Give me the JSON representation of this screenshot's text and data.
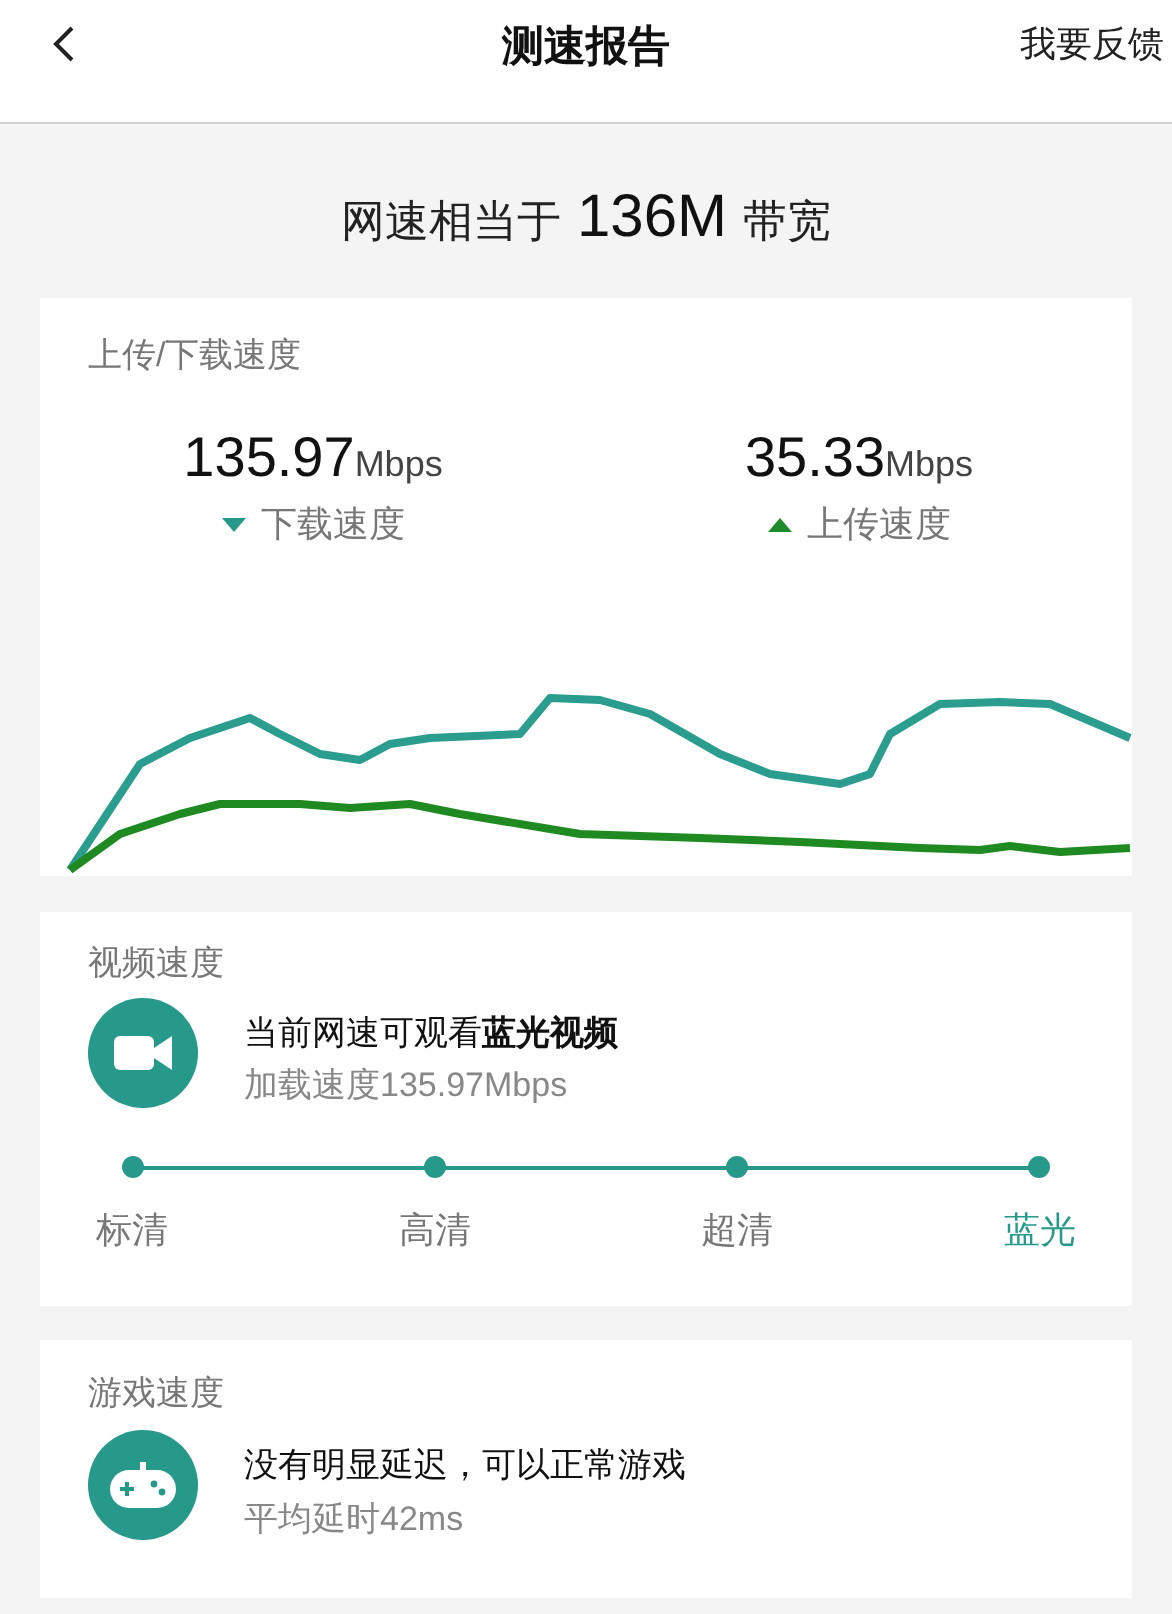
{
  "header": {
    "title": "测速报告",
    "action": "我要反馈"
  },
  "summary": {
    "prefix": "网速相当于",
    "value": "136M",
    "suffix": "带宽"
  },
  "speed_card": {
    "title": "上传/下载速度",
    "readings": [
      {
        "kind": "down",
        "value": "135.97",
        "unit": "Mbps",
        "label": "下载速度"
      },
      {
        "kind": "up",
        "value": "35.33",
        "unit": "Mbps",
        "label": "上传速度"
      }
    ]
  },
  "video_card": {
    "title": "视频速度",
    "headline": "当前网速可观看**蓝光视频**",
    "detail": "加载速度135.97Mbps",
    "levels": [
      {
        "label": "标清",
        "selected": false
      },
      {
        "label": "高清",
        "selected": false
      },
      {
        "label": "超清",
        "selected": false
      },
      {
        "label": "蓝光",
        "selected": true
      }
    ]
  },
  "game_card": {
    "title": "游戏速度",
    "headline": "没有明显延迟，可以正常游戏",
    "detail": "平均延时42ms"
  }
}
